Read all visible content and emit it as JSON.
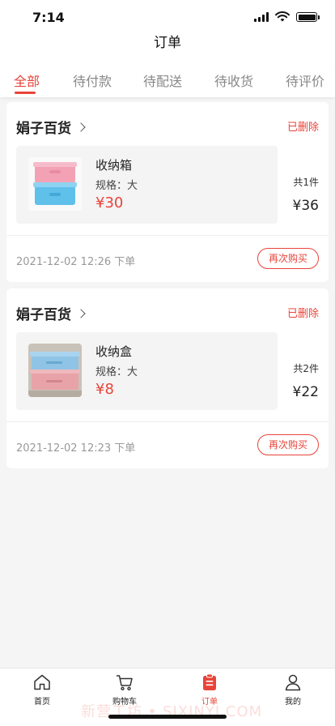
{
  "status_bar": {
    "time": "7:14"
  },
  "nav": {
    "title": "订单"
  },
  "tabs": [
    "全部",
    "待付款",
    "待配送",
    "待收货",
    "待评价"
  ],
  "orders": [
    {
      "shop": "娟子百货",
      "status": "已删除",
      "item_title": "收纳箱",
      "item_spec": "规格：大",
      "item_price": "¥30",
      "quantity": "共1件",
      "total": "¥36",
      "date": "2021-12-02 12:26 下单",
      "rebuy": "再次购买"
    },
    {
      "shop": "娟子百货",
      "status": "已删除",
      "item_title": "收纳盒",
      "item_spec": "规格：大",
      "item_price": "¥8",
      "quantity": "共2件",
      "total": "¥22",
      "date": "2021-12-02 12:23 下单",
      "rebuy": "再次购买"
    }
  ],
  "tabbar": [
    {
      "label": "首页",
      "icon": "home-icon"
    },
    {
      "label": "购物车",
      "icon": "cart-icon"
    },
    {
      "label": "订单",
      "icon": "order-icon"
    },
    {
      "label": "我的",
      "icon": "profile-icon"
    }
  ],
  "watermark": "新营工坊 • SIXINYI.COM",
  "colors": {
    "accent": "#e8443a",
    "background": "#f5f5f5"
  }
}
